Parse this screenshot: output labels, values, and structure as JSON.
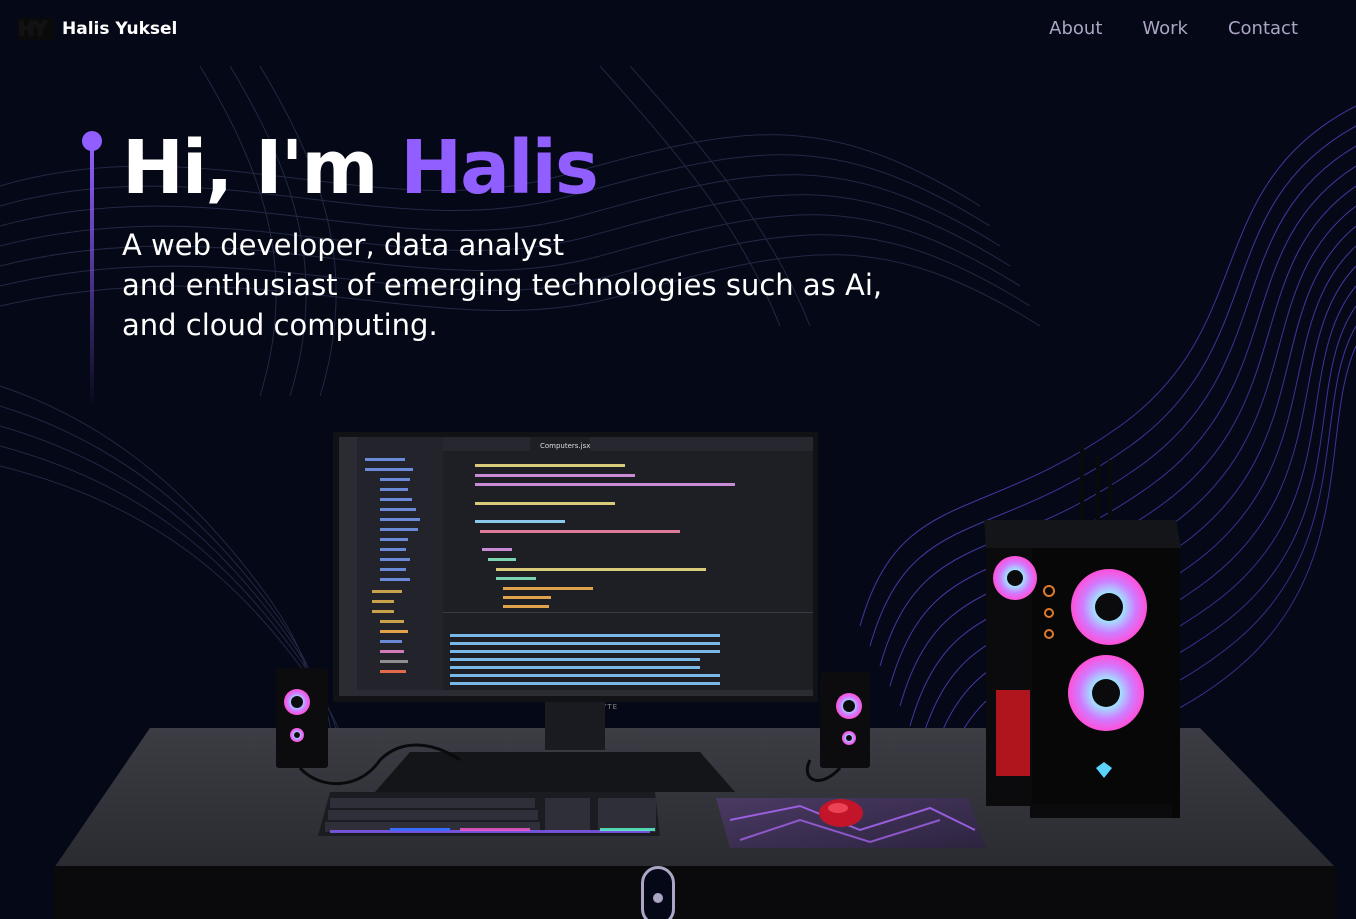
{
  "navbar": {
    "logo_text": "HY",
    "brand": "Halis Yuksel",
    "links": [
      {
        "label": "About"
      },
      {
        "label": "Work"
      },
      {
        "label": "Contact"
      }
    ]
  },
  "hero": {
    "greeting": "Hi, I'm",
    "name": "Halis",
    "subtitle_lines": [
      "A web developer, data analyst",
      "and enthusiast of emerging technologies such as Ai,",
      "and cloud computing."
    ]
  },
  "scene": {
    "monitor_brand": "GIGABYTE",
    "editor_tab": "Computers.jsx"
  },
  "colors": {
    "background": "#050816",
    "accent": "#915eff",
    "nav_text": "#aaa6c3"
  }
}
